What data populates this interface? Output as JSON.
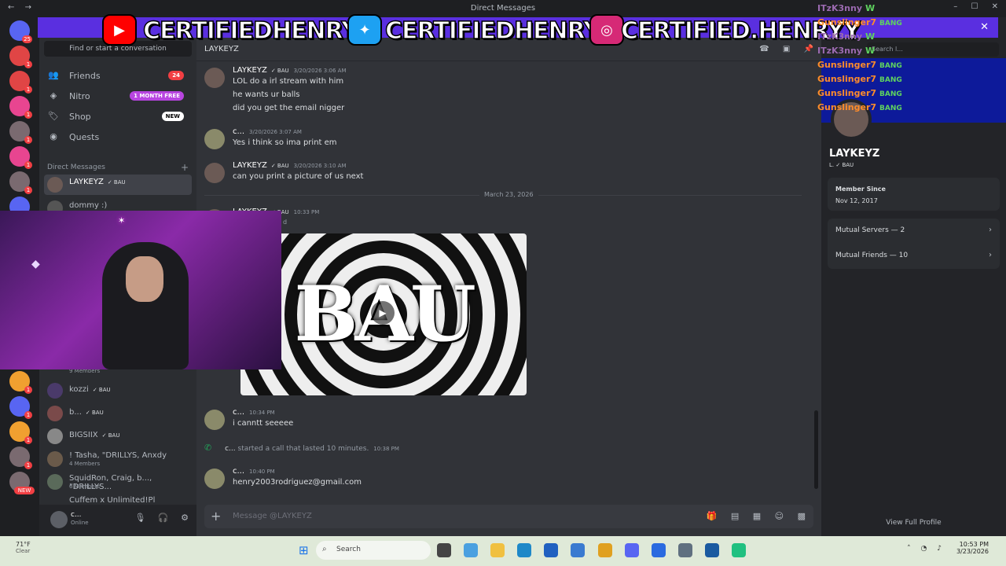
{
  "window": {
    "title": "Direct Messages",
    "nav_back": "←",
    "nav_fwd": "→",
    "min": "–",
    "max": "☐",
    "close": "✕"
  },
  "overlay": {
    "youtube_handle": "CERTIFIEDHENRY",
    "twitter_handle": "CERTIFIEDHENRY",
    "instagram_handle": "CERTIFIED.HENRYY",
    "close": "✕",
    "chat": [
      {
        "user": "ITzK3nny",
        "msg": "W"
      },
      {
        "user": "Gunslinger7",
        "msg": "BANG"
      },
      {
        "user": "ITzK3nny",
        "msg": "W"
      },
      {
        "user": "ITzK3nny",
        "msg": "W"
      },
      {
        "user": "Gunslinger7",
        "msg": "BANG"
      },
      {
        "user": "Gunslinger7",
        "msg": "BANG"
      },
      {
        "user": "Gunslinger7",
        "msg": "BANG"
      },
      {
        "user": "Gunslinger7",
        "msg": "BANG"
      }
    ]
  },
  "guilds": [
    {
      "badge": "25"
    },
    {
      "badge": "1"
    },
    {
      "badge": "1"
    },
    {
      "badge": "1"
    },
    {
      "badge": "1"
    },
    {
      "badge": "1"
    },
    {
      "badge": "1"
    },
    {
      "badge": "1"
    },
    {
      "badge": "1"
    },
    {
      "badge": "1"
    },
    {
      "badge": "1"
    },
    {
      "badge": "1"
    },
    {
      "badge": "NEW"
    }
  ],
  "sidebar": {
    "find": "Find or start a conversation",
    "friends": "Friends",
    "friends_badge": "24",
    "nitro": "Nitro",
    "nitro_badge": "1 MONTH FREE",
    "shop": "Shop",
    "shop_badge": "NEW",
    "quests": "Quests",
    "dm_header": "Direct Messages",
    "dm_add": "+",
    "dms": [
      {
        "name": "LAYKEYZ",
        "tag": "✓ BAU",
        "sub": ""
      },
      {
        "name": "dommy :)",
        "tag": "",
        "sub": ""
      },
      {
        "name": "",
        "tag": "",
        "sub": "9 Members"
      },
      {
        "name": "kozzi",
        "tag": "✓ BAU",
        "sub": ""
      },
      {
        "name": "b...",
        "tag": "✓ BAU",
        "sub": ""
      },
      {
        "name": "BIGSIIX",
        "tag": "✓ BAU",
        "sub": ""
      },
      {
        "name": "! Tasha, \"DRILLYS, Anxdy",
        "tag": "",
        "sub": "4 Members"
      },
      {
        "name": "SquidRon, Craig, b..., \"DRILLYS...",
        "tag": "",
        "sub": "6 Members"
      },
      {
        "name": "Cuffem x Unlimited!Pl",
        "tag": "",
        "sub": ""
      }
    ]
  },
  "user": {
    "name": "c...",
    "status": "Online"
  },
  "chat": {
    "header": "LAYKEYZ",
    "date_divider": "March 23, 2026",
    "messages": [
      {
        "author": "LAYKEYZ",
        "tag": "✓ BAU",
        "ts": "3/20/2026 3:06 AM",
        "lines": [
          "LOL do a irl stream with him",
          "he wants ur balls",
          "did you get the email nigger"
        ]
      },
      {
        "author": "c...",
        "tag": "",
        "ts": "3/20/2026 3:07 AM",
        "lines": [
          "Yes i think so ima print em"
        ]
      },
      {
        "author": "LAYKEYZ",
        "tag": "✓ BAU",
        "ts": "3/20/2026 3:10 AM",
        "lines": [
          "can you print a picture of us next"
        ]
      },
      {
        "author": "LAYKEYZ",
        "tag": "✓ BAU",
        "ts": "10:33 PM",
        "lines": [
          "d"
        ]
      },
      {
        "author": "c...",
        "tag": "",
        "ts": "10:34 PM",
        "lines": [
          "i canntt  seeeee"
        ]
      },
      {
        "author": "c...",
        "tag": "",
        "ts": "10:40 PM",
        "lines": [
          "henry2003rodriguez@gmail.com"
        ]
      }
    ],
    "embed_text": "BAU",
    "call": {
      "who": "c...",
      "text": "started a call that lasted 10 minutes.",
      "ts": "10:38 PM"
    },
    "composer_placeholder": "Message @LAYKEYZ"
  },
  "profile": {
    "search": "Search l...",
    "name": "LAYKEYZ",
    "tag": "L.   ✓ BAU",
    "member_since_label": "Member Since",
    "member_since": "Nov 12, 2017",
    "mutual_servers": "Mutual Servers — 2",
    "mutual_friends": "Mutual Friends — 10",
    "view_full": "View Full Profile"
  },
  "taskbar": {
    "temp": "71°F",
    "weather": "Clear",
    "search": "Search",
    "time": "10:53 PM",
    "date": "3/23/2026"
  },
  "colors": {
    "blurple": "#5865f2",
    "red": "#f23f43",
    "green": "#23a55a",
    "overlay_purple": "#5a2fe0"
  }
}
